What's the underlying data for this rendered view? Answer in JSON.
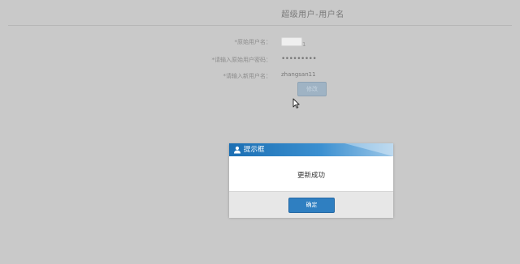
{
  "page": {
    "title": "超级用户-用户名"
  },
  "form": {
    "fields": [
      {
        "label": "*原始用户名：",
        "value": "1"
      },
      {
        "label": "*请输入原始用户密码：",
        "value": "•••••••••"
      },
      {
        "label": "*请输入新用户名：",
        "value": "zhangsan11"
      }
    ],
    "modify_label": "修改"
  },
  "dialog": {
    "title": "提示框",
    "message": "更新成功",
    "confirm_label": "确定"
  },
  "colors": {
    "overlay_bg": "#c9c9c9",
    "dialog_header": "#1c6fb3",
    "confirm_button": "#2f7fc1"
  },
  "icons": {
    "dialog": "user-icon",
    "cursor": "mouse-pointer-icon"
  }
}
